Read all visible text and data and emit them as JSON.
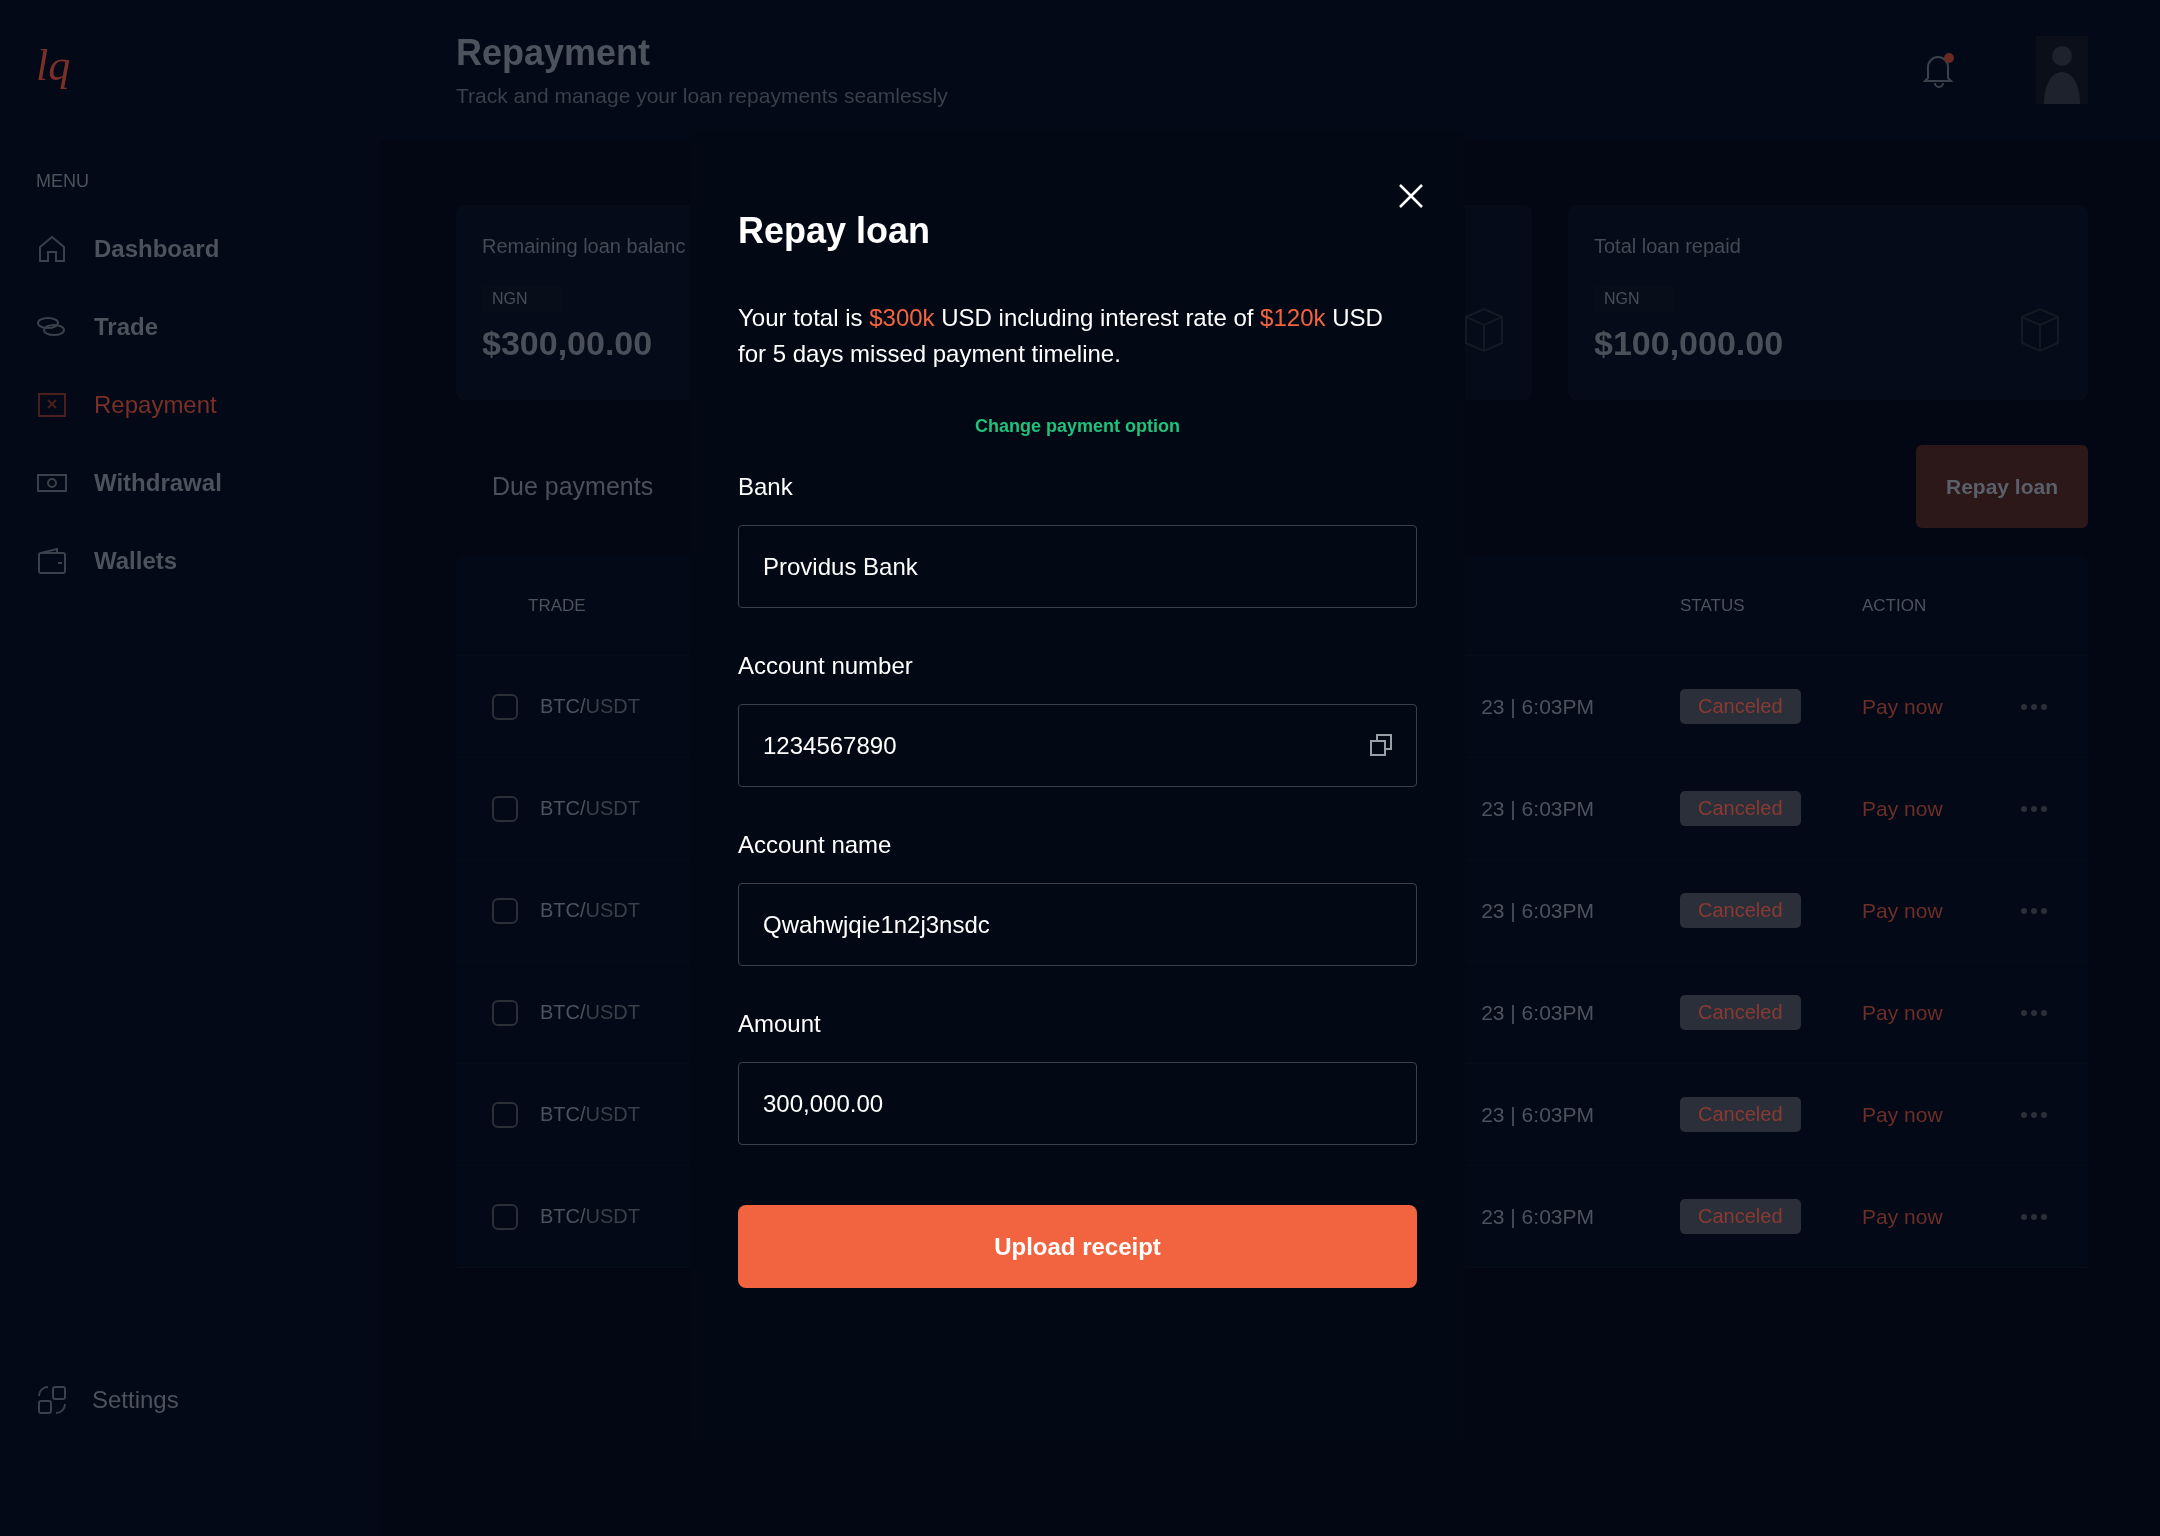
{
  "sidebar": {
    "logo": "lq",
    "menu_label": "MENU",
    "items": [
      {
        "label": "Dashboard",
        "selected": false
      },
      {
        "label": "Trade",
        "selected": false
      },
      {
        "label": "Repayment",
        "selected": true
      },
      {
        "label": "Withdrawal",
        "selected": false
      },
      {
        "label": "Wallets",
        "selected": false
      }
    ],
    "settings": "Settings"
  },
  "header": {
    "title": "Repayment",
    "subtitle": "Track and manage your loan repayments seamlessly"
  },
  "cards": [
    {
      "label": "Remaining loan balanc",
      "currency": "NGN",
      "amount": "$300,00.00"
    },
    {
      "label": "Total loan repaid",
      "currency": "NGN",
      "amount": "$100,000.00"
    }
  ],
  "due_payments": {
    "title": "Due payments",
    "button": "Repay loan"
  },
  "table": {
    "columns": [
      "TRADE",
      "STATUS",
      "ACTION"
    ],
    "rows": [
      {
        "base": "BTC/",
        "quote": "USDT",
        "time": "23 | 6:03PM",
        "status": "Canceled",
        "action": "Pay now",
        "checked": false
      },
      {
        "base": "BTC/",
        "quote": "USDT",
        "time": "23 | 6:03PM",
        "status": "Canceled",
        "action": "Pay now",
        "checked": false
      },
      {
        "base": "BTC/",
        "quote": "USDT",
        "time": "23 | 6:03PM",
        "status": "Canceled",
        "action": "Pay now",
        "checked": false
      },
      {
        "base": "BTC/",
        "quote": "USDT",
        "time": "23 | 6:03PM",
        "status": "Canceled",
        "action": "Pay now",
        "checked": false
      },
      {
        "base": "BTC/",
        "quote": "USDT",
        "time": "23 | 6:03PM",
        "status": "Canceled",
        "action": "Pay now",
        "checked": false
      },
      {
        "base": "BTC/",
        "quote": "USDT",
        "time": "23 | 6:03PM",
        "status": "Canceled",
        "action": "Pay now",
        "checked": false
      }
    ]
  },
  "modal": {
    "title": "Repay loan",
    "message": "Your total is **$300k** USD including interest rate of **$120k** USD for 5 days missed payment timeline.",
    "link": "Change payment option",
    "fields": [
      {
        "label": "Bank",
        "value": "Providus Bank",
        "kind": "text"
      },
      {
        "label": "Account number",
        "value": "1234567890",
        "kind": "copy"
      },
      {
        "label": "Account name",
        "value": "Qwahwjqie1n2j3nsdc",
        "kind": "text"
      },
      {
        "label": "Amount",
        "value": "300,000.00",
        "kind": "text"
      }
    ],
    "button": "Upload receipt"
  }
}
